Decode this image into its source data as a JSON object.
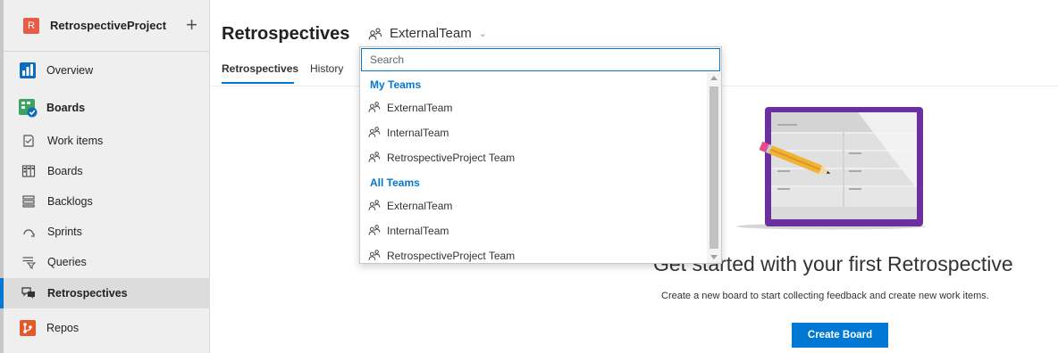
{
  "project": {
    "avatar_letter": "R",
    "name": "RetrospectiveProject",
    "add_symbol": "+"
  },
  "nav": {
    "overview": "Overview",
    "boards_section": "Boards",
    "work_items": "Work items",
    "boards": "Boards",
    "backlogs": "Backlogs",
    "sprints": "Sprints",
    "queries": "Queries",
    "retrospectives": "Retrospectives",
    "repos": "Repos"
  },
  "header": {
    "title": "Retrospectives",
    "team_selected": "ExternalTeam"
  },
  "tabs": {
    "retrospectives": "Retrospectives",
    "history": "History"
  },
  "dropdown": {
    "search_placeholder": "Search",
    "my_teams_label": "My Teams",
    "my_teams": [
      "ExternalTeam",
      "InternalTeam",
      "RetrospectiveProject Team"
    ],
    "all_teams_label": "All Teams",
    "all_teams": [
      "ExternalTeam",
      "InternalTeam",
      "RetrospectiveProject Team"
    ]
  },
  "empty_state": {
    "title": "Get started with your first Retrospective",
    "description": "Create a new board to start collecting feedback and create new work items.",
    "button_label": "Create Board"
  },
  "colors": {
    "accent": "#0078d4",
    "board_frame": "#6b2fa0",
    "project_avatar": "#e55d45"
  },
  "icons": {
    "team": "team-icon",
    "overview": "overview-icon",
    "boards_section": "boards-section-icon",
    "work_items": "work-items-icon",
    "boards": "boards-icon",
    "backlogs": "backlogs-icon",
    "sprints": "sprints-icon",
    "queries": "queries-icon",
    "retrospectives": "retrospectives-icon",
    "repos": "repos-icon"
  }
}
